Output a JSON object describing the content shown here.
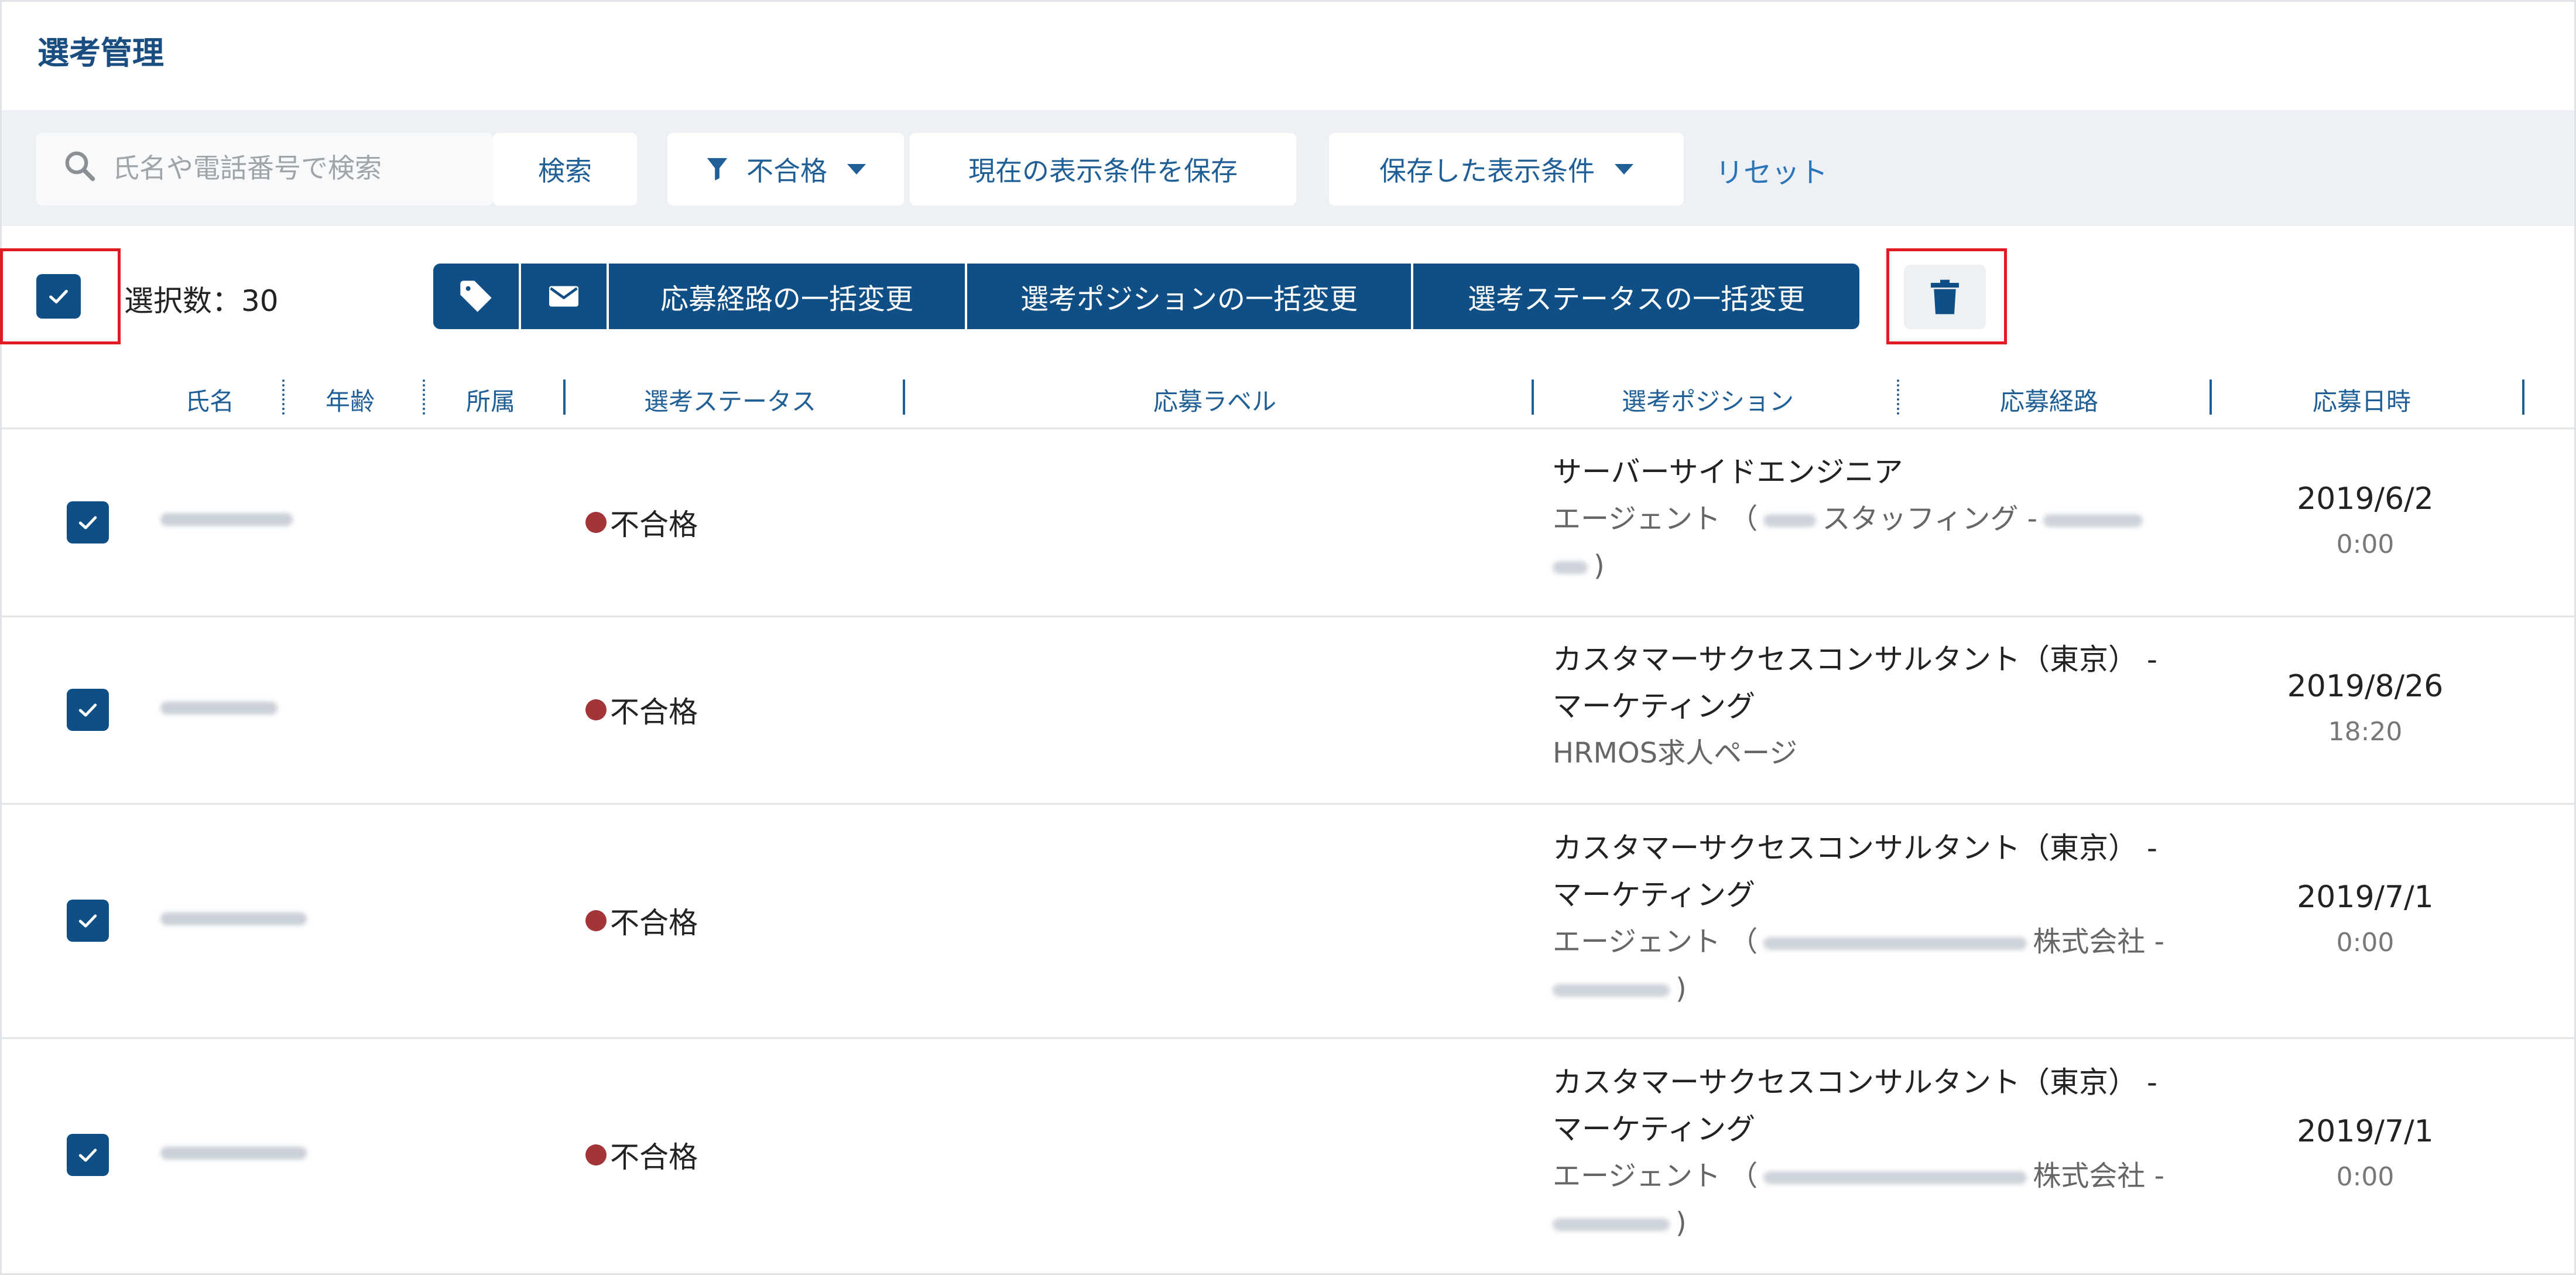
{
  "page": {
    "title": "選考管理"
  },
  "toolbar": {
    "search_placeholder": "氏名や電話番号で検索",
    "search_button": "検索",
    "status_filter": "不合格",
    "save_conditions": "現在の表示条件を保存",
    "saved_conditions": "保存した表示条件",
    "reset": "リセット"
  },
  "selection": {
    "count_label": "選択数：30"
  },
  "bulk_actions": {
    "change_route": "応募経路の一括変更",
    "change_position": "選考ポジションの一括変更",
    "change_status": "選考ステータスの一括変更"
  },
  "columns": {
    "name": "氏名",
    "age": "年齢",
    "affiliation": "所属",
    "status": "選考ステータス",
    "label": "応募ラベル",
    "position": "選考ポジション",
    "route": "応募経路",
    "datetime": "応募日時"
  },
  "rows": [
    {
      "status": "不合格",
      "position_line1": "サーバーサイドエンジニア",
      "route_prefix": "エージェント （",
      "route_middle": "スタッフィング -",
      "route_end": ")",
      "date": "2019/6/2",
      "time": "0:00"
    },
    {
      "status": "不合格",
      "position_line1": "カスタマーサクセスコンサルタント（東京） -",
      "position_line2": "マーケティング",
      "route": "HRMOS求人ページ",
      "date": "2019/8/26",
      "time": "18:20"
    },
    {
      "status": "不合格",
      "position_line1": "カスタマーサクセスコンサルタント（東京） -",
      "position_line2": "マーケティング",
      "route_prefix": "エージェント （",
      "route_middle": "株式会社 -",
      "route_end": ")",
      "date": "2019/7/1",
      "time": "0:00"
    },
    {
      "status": "不合格",
      "position_line1": "カスタマーサクセスコンサルタント（東京） -",
      "position_line2": "マーケティング",
      "route_prefix": "エージェント （",
      "route_middle": "株式会社 -",
      "route_end": ")",
      "date": "2019/7/1",
      "time": "0:00"
    }
  ]
}
